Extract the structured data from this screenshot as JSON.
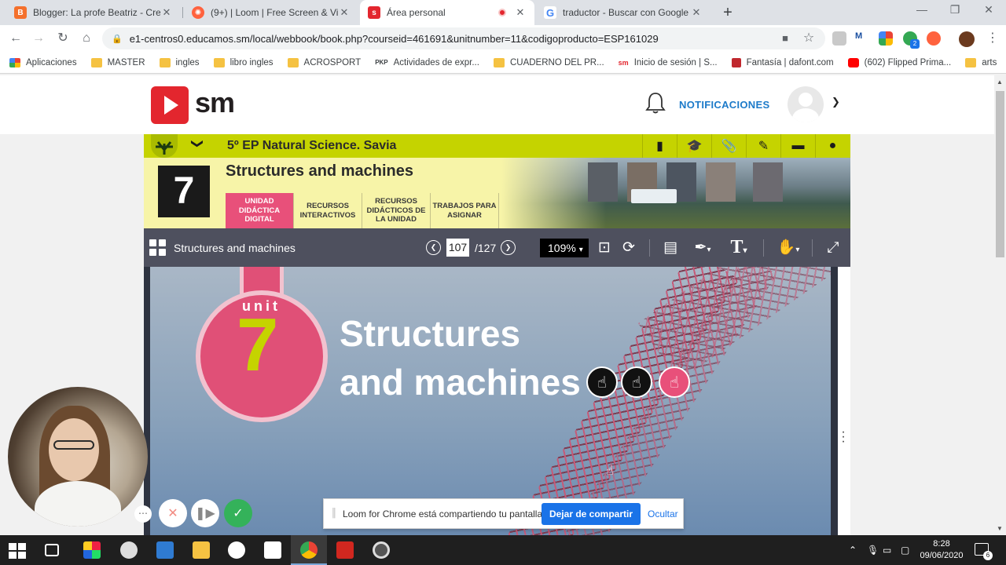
{
  "browser": {
    "tabs": [
      {
        "title": "Blogger: La profe Beatriz - Crear",
        "favicon_color": "#f4702c",
        "active": false
      },
      {
        "title": "(9+) | Loom | Free Screen & Vide",
        "favicon_color": "#ff623e",
        "active": false
      },
      {
        "title": "Área personal",
        "favicon_color": "#e3262e",
        "active": true
      },
      {
        "title": "traductor - Buscar con Google",
        "favicon_color": "#4285f4",
        "active": false
      }
    ],
    "url": "e1-centros0.educamos.sm/local/webbook/book.php?courseid=461691&unitnumber=11&codigoproducto=ESP161029",
    "bookmarks": [
      {
        "label": "Aplicaciones",
        "icon": "apps-grid-icon"
      },
      {
        "label": "MASTER",
        "icon": "folder-icon"
      },
      {
        "label": "ingles",
        "icon": "folder-icon"
      },
      {
        "label": "libro ingles",
        "icon": "folder-icon"
      },
      {
        "label": "ACROSPORT",
        "icon": "folder-icon"
      },
      {
        "label": "Actividades de expr...",
        "icon": "pkp-icon"
      },
      {
        "label": "CUADERNO DEL PR...",
        "icon": "folder-icon"
      },
      {
        "label": "Inicio de sesión | S...",
        "icon": "sm-icon"
      },
      {
        "label": "Fantasía | dafont.com",
        "icon": "dafont-icon"
      },
      {
        "label": "(602) Flipped Prima...",
        "icon": "youtube-icon"
      },
      {
        "label": "arts",
        "icon": "folder-icon"
      }
    ],
    "bookmark_prefix": {
      "pkp": "PKP",
      "sm": "sm"
    }
  },
  "sm": {
    "logo_text": "sm",
    "notifications_label": "NOTIFICACIONES"
  },
  "course": {
    "title": "5º EP Natural Science. Savia",
    "unit_number": "7",
    "unit_title": "Structures and machines",
    "tabs": [
      {
        "label": "UNIDAD DIDÁCTICA DIGITAL",
        "active": true
      },
      {
        "label": "RECURSOS INTERACTIVOS",
        "active": false
      },
      {
        "label": "RECURSOS DIDÁCTICOS DE LA UNIDAD",
        "active": false
      },
      {
        "label": "TRABAJOS PARA ASIGNAR",
        "active": false
      }
    ]
  },
  "viewer": {
    "title": "Structures and machines",
    "page": "107",
    "total_pages": "/127",
    "zoom": "109%"
  },
  "page": {
    "unit_word": "unit",
    "unit_number": "7",
    "title_line1": "Structures",
    "title_line2": "and machines"
  },
  "loom": {
    "message": "Loom for Chrome está compartiendo tu pantalla.",
    "stop_label": "Dejar de compartir",
    "hide_label": "Ocultar"
  },
  "taskbar": {
    "time": "8:28",
    "date": "09/06/2020",
    "notification_count": "6"
  },
  "extensions": {
    "badge_count": "2"
  },
  "colors": {
    "sm_red": "#e3262e",
    "course_green": "#c5d300",
    "unit_pink": "#e8507a",
    "viewer_bar": "#4e505e",
    "link_blue": "#1c7ac9"
  }
}
